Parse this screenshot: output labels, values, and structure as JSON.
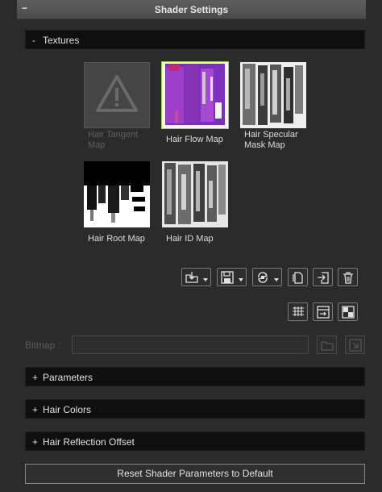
{
  "header": {
    "collapse_icon": "−",
    "title": "Shader Settings"
  },
  "textures": {
    "sign": "-",
    "label": "Textures",
    "items": [
      {
        "label": "Hair Tangent\nMap",
        "state": "empty"
      },
      {
        "label": "Hair Flow Map",
        "state": "selected"
      },
      {
        "label": "Hair Specular\nMask Map",
        "state": "loaded"
      },
      {
        "label": "Hair Root Map",
        "state": "loaded"
      },
      {
        "label": "Hair ID Map",
        "state": "loaded"
      }
    ]
  },
  "toolbar": {
    "row1": [
      "load-folder-icon",
      "save-icon",
      "swap-icon",
      "copy-icon",
      "import-icon",
      "trash-icon"
    ],
    "row2": [
      "grid-icon",
      "export-icon",
      "checker-icon"
    ]
  },
  "bitmap": {
    "label": "Bitmap :",
    "value": ""
  },
  "sections": [
    {
      "sign": "+",
      "label": "Parameters"
    },
    {
      "sign": "+",
      "label": "Hair Colors"
    },
    {
      "sign": "+",
      "label": "Hair Reflection Offset"
    }
  ],
  "reset_label": "Reset Shader Parameters to Default",
  "colors": {
    "selection": "#9fd34a",
    "panel_bg": "#2b2b2b",
    "section_bg": "#0f0f0f"
  }
}
